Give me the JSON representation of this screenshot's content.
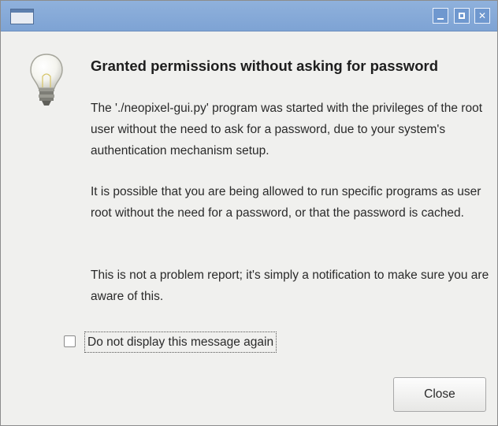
{
  "window": {
    "title": "",
    "controls": {
      "minimize": "minimize-icon",
      "maximize": "maximize-icon",
      "close": "close-icon"
    },
    "titlebar_color": "#7ea3d4"
  },
  "dialog": {
    "icon": "lightbulb-icon",
    "heading": "Granted permissions without asking for password",
    "paragraphs": [
      "The './neopixel-gui.py' program was started with the privileges of the root user without the need to ask for a password, due to your system's authentication mechanism setup.",
      "It is possible that you are being allowed to run specific programs as user root without the need for a password, or that the password is cached.",
      "This is not a problem report; it's simply a notification to make sure you are aware of this."
    ],
    "checkbox": {
      "label": "Do not display this message again",
      "checked": false
    },
    "close_label": "Close"
  }
}
